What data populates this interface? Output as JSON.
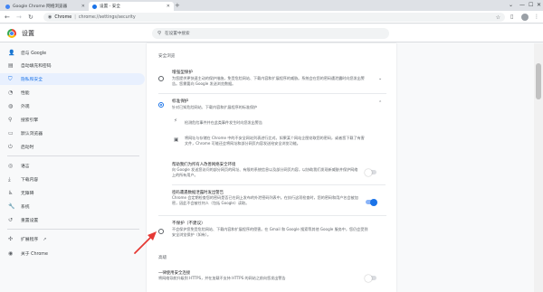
{
  "tabs": [
    {
      "title": "Google Chrome 网络浏览器",
      "active": false
    },
    {
      "title": "设置 - 安全",
      "active": true
    }
  ],
  "window_controls": [
    "—",
    "☐",
    "✕"
  ],
  "address_bar": {
    "site_chip": "Chrome",
    "separator": "|",
    "url": "chrome://settings/security"
  },
  "app": {
    "title": "设置",
    "search_placeholder": "在设置中搜索"
  },
  "sidebar": {
    "items": [
      {
        "label": "您与 Google",
        "icon": "person-icon"
      },
      {
        "label": "自动填充和密码",
        "icon": "clipboard-icon"
      },
      {
        "label": "隐私和安全",
        "icon": "shield-icon",
        "active": true
      },
      {
        "label": "性能",
        "icon": "speedometer-icon"
      },
      {
        "label": "外观",
        "icon": "palette-icon"
      },
      {
        "label": "搜索引擎",
        "icon": "search-icon"
      },
      {
        "label": "默认浏览器",
        "icon": "browser-icon"
      },
      {
        "label": "启动时",
        "icon": "power-icon"
      },
      {
        "label": "语言",
        "icon": "globe-icon"
      },
      {
        "label": "下载内容",
        "icon": "download-icon"
      },
      {
        "label": "无障碍",
        "icon": "accessibility-icon"
      },
      {
        "label": "系统",
        "icon": "wrench-icon"
      },
      {
        "label": "重置设置",
        "icon": "reset-icon"
      },
      {
        "label": "扩展程序",
        "icon": "puzzle-icon"
      },
      {
        "label": "关于 Chrome",
        "icon": "chrome-logo-icon"
      }
    ]
  },
  "main": {
    "section_title": "安全浏览",
    "enhanced": {
      "title": "增强型保护",
      "desc": "为您提供更快速主动的保护措施，免受危险网站、下载内容和扩展程序的威胁。系统会在您的密码遭泄露时向您发出警告。您需要向 Google 发送浏览数据。"
    },
    "standard": {
      "title": "标准保护",
      "desc": "针对已知危险网站、下载内容和扩展程序的标准保护",
      "features": [
        "检测危险事件并在此类事件发生时向您发出警告",
        "将网址与存储在 Chrome 中的不安全网站列表进行比对。如果某个网站企图窃取您的密码，或者您下载了有害文件，Chrome 可能还会将网址和部分网页内容发送给安全浏览功能。"
      ]
    },
    "help_improve": {
      "title": "帮助我们为所有人改善网络安全环境",
      "desc": "向 Google 发送您访问的部分网页的网址、有限的系统信息以及部分网页内容，以协助我们发现新威胁并保护网络上的所有用户。"
    },
    "password_leak": {
      "title": "密码遭遇数据泄露时发出警告",
      "desc": "Chrome 会定期检查您的密码是否已在网上发布的外泄密码列表中。在执行这项检查时，您的密码和用户名会被加密，因此不会被任何人（包括 Google）读取。"
    },
    "no_protection": {
      "title": "不保护（不建议）",
      "desc": "不会保护您免受危险网站、下载内容和扩展程序的侵害。在 Gmail 和 Google 搜索等其他 Google 服务中，您仍会受到安全浏览保护（如有）。"
    },
    "advanced_title": "高级",
    "always_secure": {
      "title": "一律使用安全连接",
      "desc": "将网络导航升级到 HTTPS，并在加载不支持 HTTPS 的网站之前向您发出警告"
    }
  },
  "colors": {
    "accent": "#1a73e8",
    "annotation_arrow": "#e53935"
  }
}
